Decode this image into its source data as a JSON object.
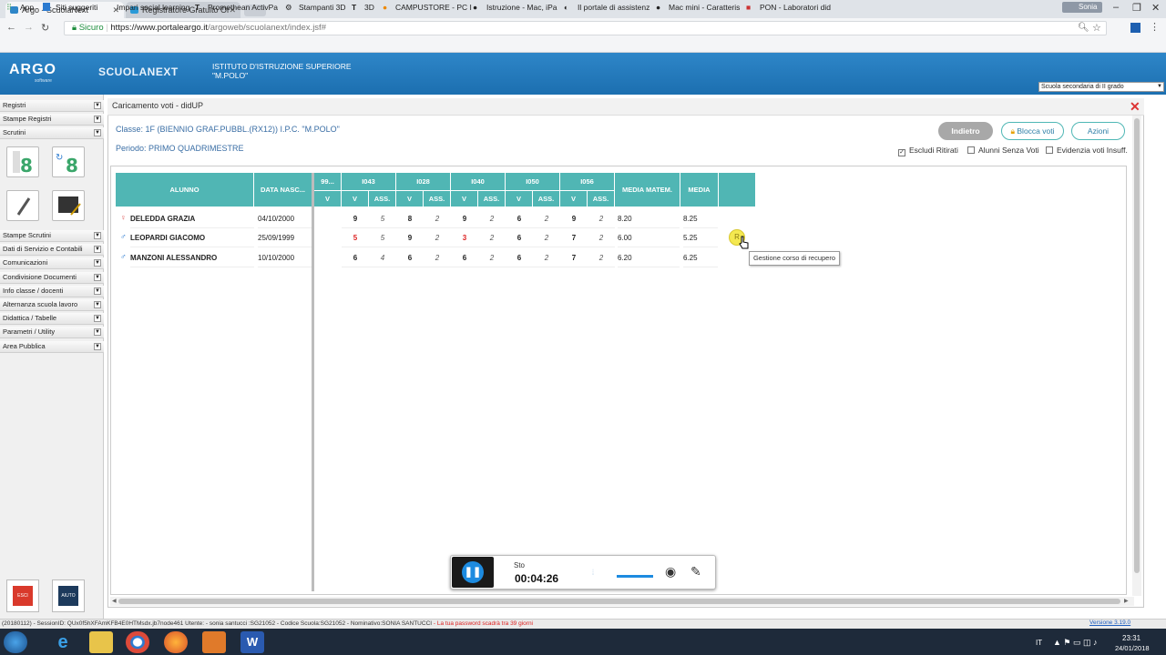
{
  "browser": {
    "tabs": [
      {
        "title": "Argo - ScuolaNext",
        "active": true
      },
      {
        "title": "Registratore Gratuito Or",
        "active": false
      }
    ],
    "profile": "Sonia",
    "security_label": "Sicuro",
    "url_host": "https://www.portaleargo.it",
    "url_path": "/argoweb/scuolanext/index.jsf#",
    "bookmarks": [
      "App",
      "Siti suggeriti",
      "Impari social learning",
      "Promethean ActivPa",
      "Stampanti 3D",
      "3D",
      "CAMPUSTORE - PC I",
      "Istruzione - Mac, iPa",
      "Il portale di assistenz",
      "Mac mini - Caratteris",
      "PON - Laboratori did"
    ]
  },
  "header": {
    "logo": "ARGO",
    "logo_sub": "software",
    "product": "SCUOLANEXT",
    "institute_line1": "ISTITUTO D'ISTRUZIONE SUPERIORE",
    "institute_line2": "\"M.POLO\"",
    "school_type": "Scuola secondaria di II grado"
  },
  "sidebar": {
    "top_items": [
      "Registri",
      "Stampe Registri",
      "Scrutini"
    ],
    "items": [
      "Stampe Scrutini",
      "Dati di Servizio e Contabili",
      "Comunicazioni",
      "Condivisione Documenti",
      "Info classe / docenti",
      "Alternanza scuola lavoro",
      "Didattica / Tabelle",
      "Parametri / Utility",
      "Area Pubblica"
    ],
    "exit_label": "ESCI",
    "help_label": "AIUTO"
  },
  "main": {
    "title": "Caricamento voti - didUP",
    "classe": "Classe: 1F (BIENNIO GRAF.PUBBL.(RX12)) I.P.C. \"M.POLO\"",
    "periodo": "Periodo: PRIMO QUADRIMESTRE",
    "buttons": {
      "back": "Indietro",
      "lock": "Blocca voti",
      "actions": "Azioni"
    },
    "checkboxes": [
      {
        "label": "Escludi Ritirati",
        "checked": true
      },
      {
        "label": "Alunni Senza Voti",
        "checked": false
      },
      {
        "label": "Evidenzia voti Insuff.",
        "checked": false
      }
    ],
    "grid": {
      "headers": {
        "student": "ALUNNO",
        "birth": "DATA NASC...",
        "col99": "99...",
        "v": "V",
        "ass": "ASS.",
        "media_matem": "MEDIA MATEM.",
        "media": "MEDIA"
      },
      "subjects": [
        "I043",
        "I028",
        "I040",
        "I050",
        "I056"
      ],
      "rows": [
        {
          "gender": "female",
          "name": "DELEDDA GRAZIA",
          "birth": "04/10/2000",
          "grades": [
            [
              "9",
              "5"
            ],
            [
              "8",
              "2"
            ],
            [
              "9",
              "2"
            ],
            [
              "6",
              "2"
            ],
            [
              "9",
              "2"
            ]
          ],
          "media_matem": "8.20",
          "media": "8.25"
        },
        {
          "gender": "male",
          "name": "LEOPARDI GIACOMO",
          "birth": "25/09/1999",
          "grades": [
            [
              "5",
              "5"
            ],
            [
              "9",
              "2"
            ],
            [
              "3",
              "2"
            ],
            [
              "6",
              "2"
            ],
            [
              "7",
              "2"
            ]
          ],
          "media_matem": "6.00",
          "media": "5.25"
        },
        {
          "gender": "male",
          "name": "MANZONI ALESSANDRO",
          "birth": "10/10/2000",
          "grades": [
            [
              "6",
              "4"
            ],
            [
              "6",
              "2"
            ],
            [
              "6",
              "2"
            ],
            [
              "6",
              "2"
            ],
            [
              "7",
              "2"
            ]
          ],
          "media_matem": "6.20",
          "media": "6.25"
        }
      ],
      "insufficient": [
        [
          1,
          0
        ],
        [
          1,
          2
        ]
      ],
      "recovery_button": "R",
      "tooltip": "Gestione corso di recupero"
    }
  },
  "recorder": {
    "status": "Sto",
    "time": "00:04:26"
  },
  "statusbar": {
    "session": "(20180112) - SessionID: QUx0f5hXFAmKFB4E0HTMsdx.jb7node461 Utente: - sonia santucci :SG21052 - Codice Scuola:SG21052 - Nominativo:SONIA SANTUCCI",
    "warning": "- La tua password scadrà tra 39 giorni",
    "version": "Versione 3.19.0"
  },
  "taskbar": {
    "lang": "IT",
    "time": "23:31",
    "date": "24/01/2018"
  }
}
